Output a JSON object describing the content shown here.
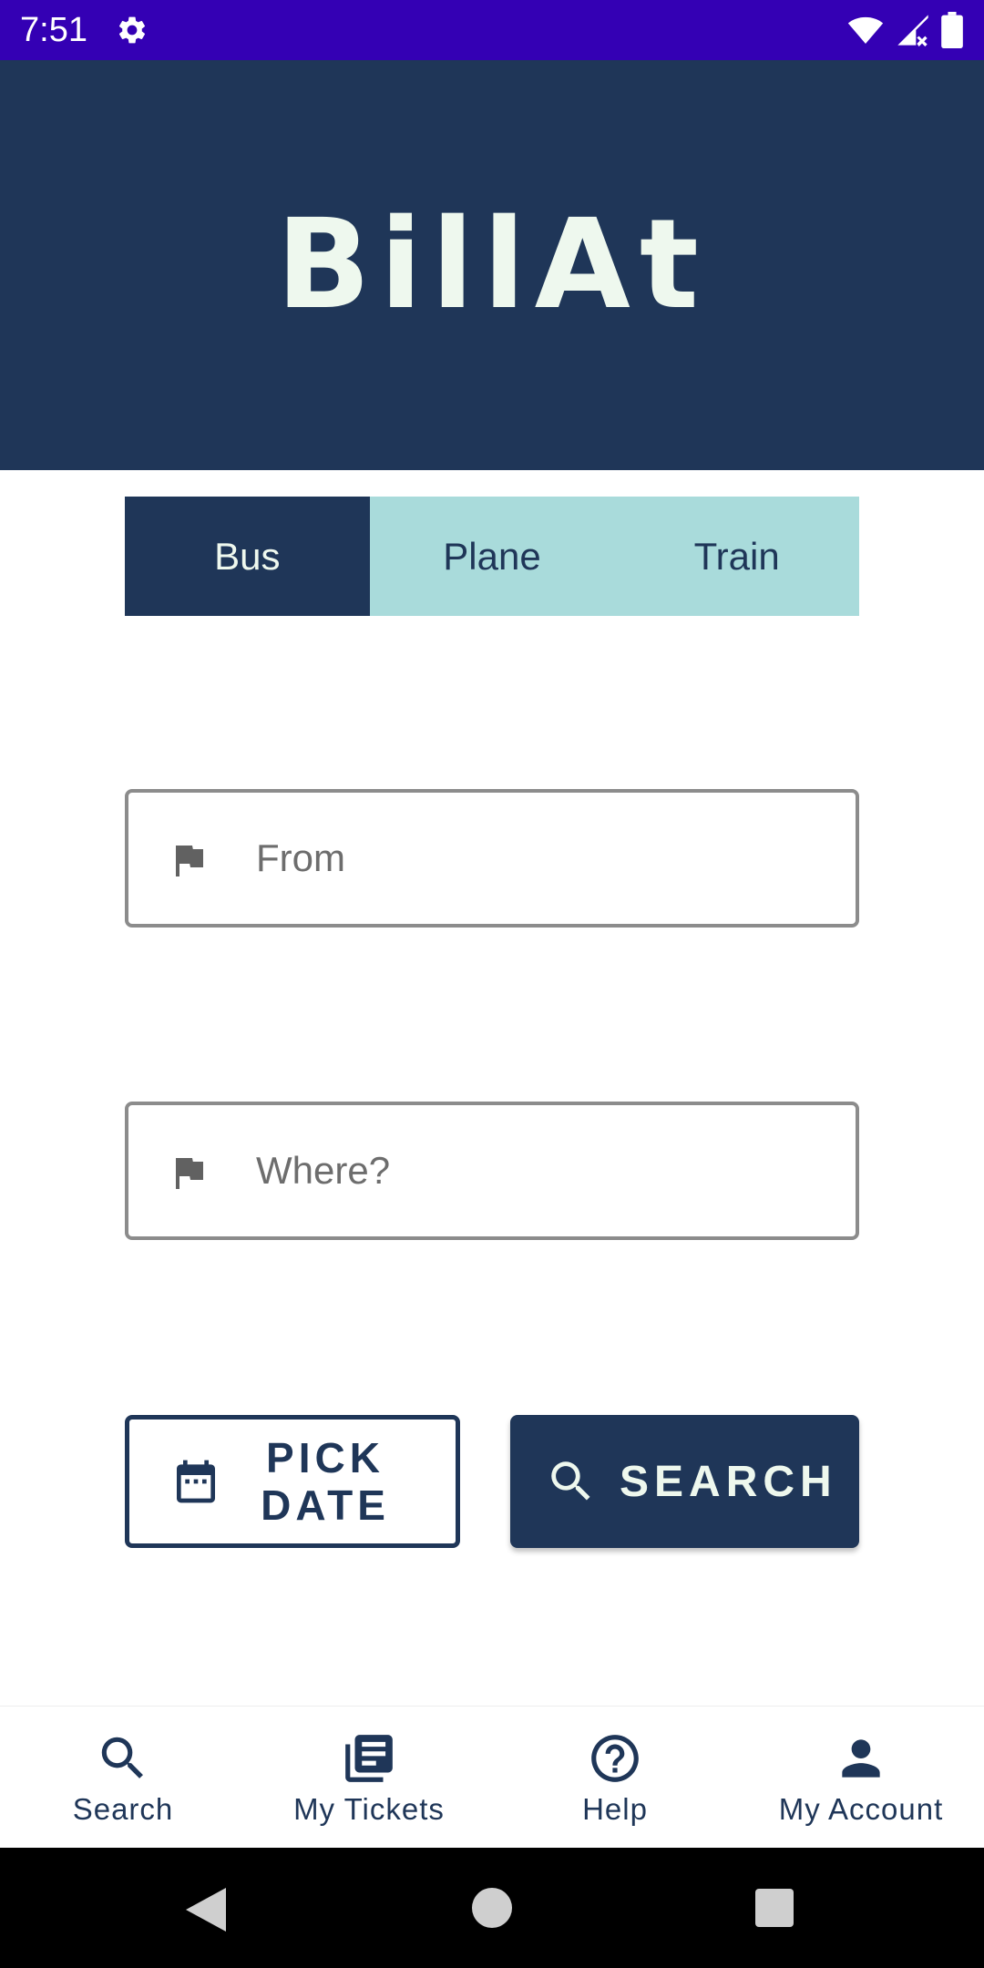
{
  "status_bar": {
    "time": "7:51"
  },
  "header": {
    "title": "BillAt"
  },
  "tabs": [
    {
      "label": "Bus",
      "active": true
    },
    {
      "label": "Plane",
      "active": false
    },
    {
      "label": "Train",
      "active": false
    }
  ],
  "from_field": {
    "placeholder": "From",
    "value": "",
    "icon": "flag-icon"
  },
  "where_field": {
    "placeholder": "Where?",
    "value": "",
    "icon": "flag-icon"
  },
  "pick_date_button": {
    "label": "PICK DATE",
    "icon": "calendar-icon"
  },
  "search_button": {
    "label": "SEARCH",
    "icon": "search-icon"
  },
  "bottom_nav": [
    {
      "label": "Search",
      "icon": "search-icon"
    },
    {
      "label": "My Tickets",
      "icon": "tickets-icon"
    },
    {
      "label": "Help",
      "icon": "help-icon"
    },
    {
      "label": "My Account",
      "icon": "account-icon"
    }
  ],
  "colors": {
    "primary": "#1f3658",
    "accent_tab": "#a9dbdb",
    "status_bar": "#3400b4",
    "title_text": "#eef8ee"
  }
}
